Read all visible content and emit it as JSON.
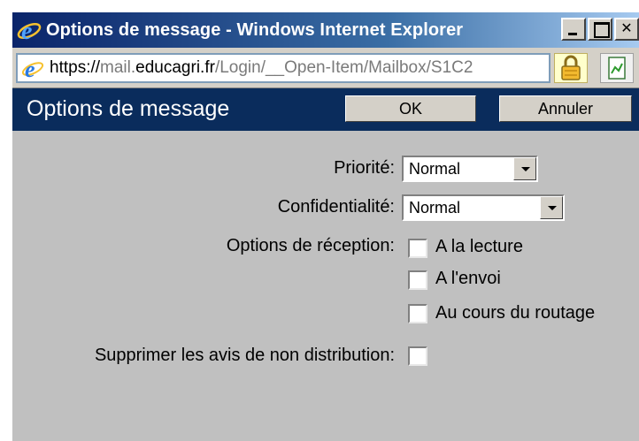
{
  "window": {
    "title": "Options de message - Windows Internet Explorer",
    "url_parts": [
      "https://",
      "mail.",
      "educagri.fr",
      "/Login/__Open-Item/Mailbox/S1C2"
    ]
  },
  "header": {
    "title": "Options de message",
    "ok_label": "OK",
    "cancel_label": "Annuler"
  },
  "form": {
    "priority_label": "Priorité:",
    "priority_value": "Normal",
    "confidentiality_label": "Confidentialité:",
    "confidentiality_value": "Normal",
    "receipt_label": "Options de réception:",
    "receipt_options": [
      {
        "label": "A la lecture",
        "checked": false
      },
      {
        "label": "A l'envoi",
        "checked": false
      },
      {
        "label": "Au cours du routage",
        "checked": false
      }
    ],
    "suppress_label": "Supprimer les avis de non distribution:",
    "suppress_checked": false
  },
  "colors": {
    "header_bg": "#0a2c5c",
    "window_bg": "#c0c0c0",
    "titlebar_start": "#0a246a"
  },
  "icons": [
    "internet-explorer-icon",
    "lock-icon",
    "page-icon",
    "minimize-icon",
    "maximize-icon",
    "close-icon"
  ]
}
